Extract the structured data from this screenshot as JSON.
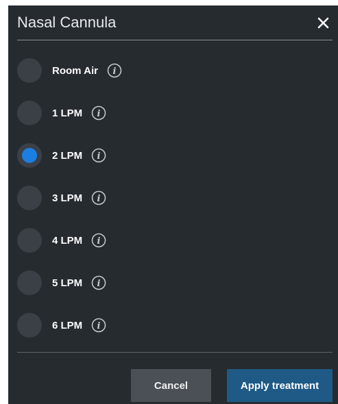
{
  "dialog": {
    "title": "Nasal Cannula",
    "close_icon": "close-icon"
  },
  "options": [
    {
      "label": "Room Air",
      "selected": false,
      "icon": "info-icon"
    },
    {
      "label": "1 LPM",
      "selected": false,
      "icon": "info-icon"
    },
    {
      "label": "2 LPM",
      "selected": true,
      "icon": "info-icon"
    },
    {
      "label": "3 LPM",
      "selected": false,
      "icon": "info-icon"
    },
    {
      "label": "4 LPM",
      "selected": false,
      "icon": "info-icon"
    },
    {
      "label": "5 LPM",
      "selected": false,
      "icon": "info-icon"
    },
    {
      "label": "6 LPM",
      "selected": false,
      "icon": "info-icon"
    }
  ],
  "footer": {
    "cancel_label": "Cancel",
    "apply_label": "Apply treatment"
  },
  "colors": {
    "background": "#262b30",
    "radio_unselected": "#3a4046",
    "radio_selected": "#1b7fe2",
    "cancel_button": "#4b5056",
    "apply_button": "#1e5a85"
  }
}
